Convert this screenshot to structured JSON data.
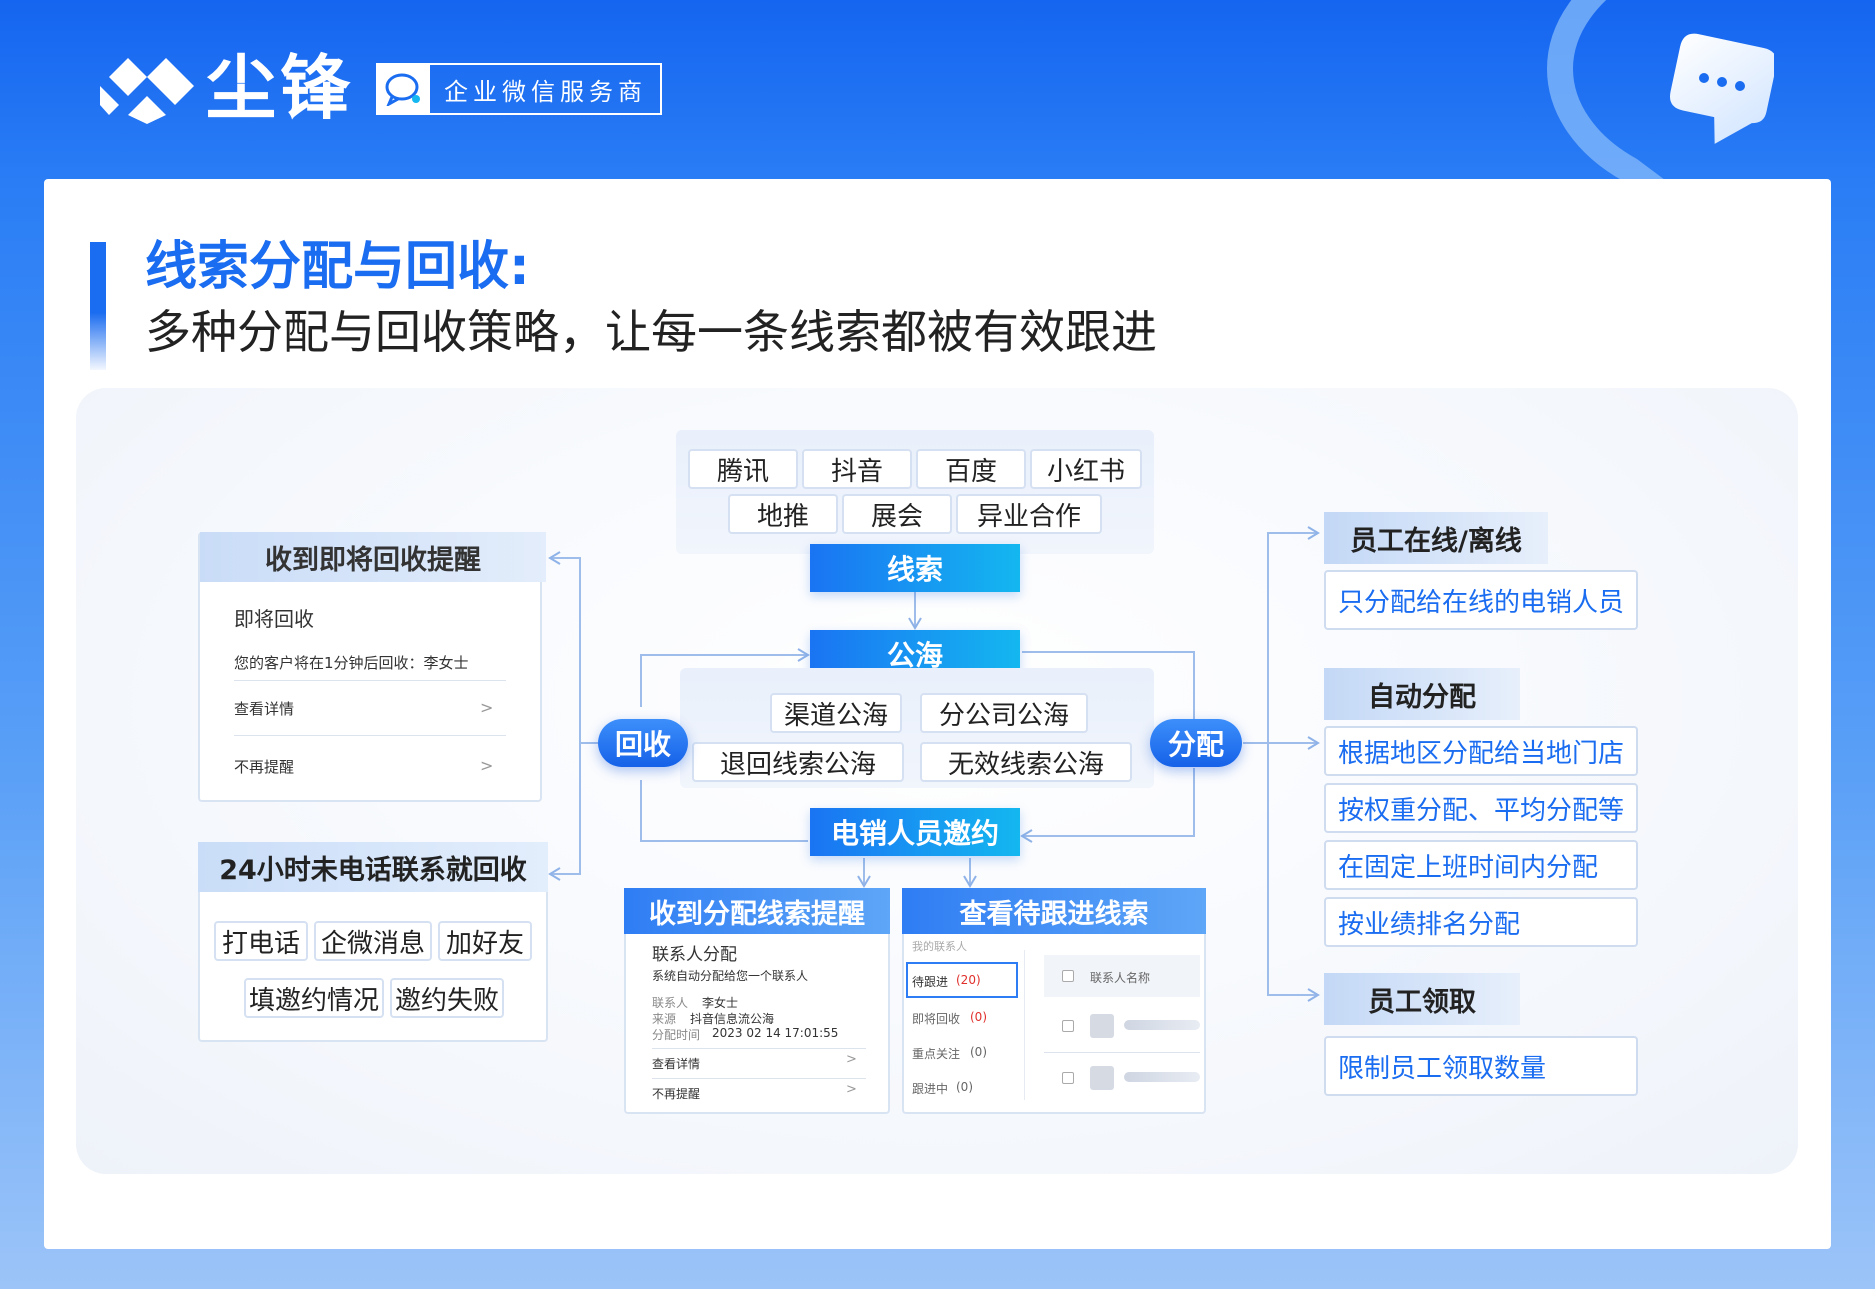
{
  "header": {
    "brand": "尘锋",
    "service_badge": "企业微信服务商",
    "colors": {
      "primary": "#1a6cf0",
      "accent": "#14b7f0"
    }
  },
  "title": {
    "main": "线索分配与回收:",
    "sub": "多种分配与回收策略，让每一条线索都被有效跟进"
  },
  "sources": {
    "row1": [
      "腾讯",
      "抖音",
      "百度",
      "小红书"
    ],
    "row2": [
      "地推",
      "展会",
      "异业合作"
    ]
  },
  "flow": {
    "leads": "线索",
    "public_sea": "公海",
    "telesales_invite": "电销人员邀约",
    "recycle": "回收",
    "assign": "分配"
  },
  "sea_types": {
    "row1": [
      "渠道公海",
      "分公司公海"
    ],
    "row2": [
      "退回线索公海",
      "无效线索公海"
    ]
  },
  "recycle_reminder": {
    "header": "收到即将回收提醒",
    "title": "即将回收",
    "message": "您的客户将在1分钟后回收：李女士",
    "view_details": "查看详情",
    "no_remind": "不再提醒"
  },
  "recycle_24h": {
    "header": "24小时未电话联系就回收",
    "row1": [
      "打电话",
      "企微消息",
      "加好友"
    ],
    "row2": [
      "填邀约情况",
      "邀约失败"
    ]
  },
  "assign_reminder": {
    "header": "收到分配线索提醒",
    "title": "联系人分配",
    "message": "系统自动分配给您一个联系人",
    "contact_label": "联系人",
    "contact_value": "李女士",
    "source_label": "来源",
    "source_value": "抖音信息流公海",
    "time_label": "分配时间",
    "time_value": "2023 02 14  17:01:55",
    "view_details": "查看详情",
    "no_remind": "不再提醒"
  },
  "pending_leads": {
    "header": "查看待跟进线索",
    "sidebar_title": "我的联系人",
    "tabs": [
      {
        "label": "待跟进",
        "count": "(20)"
      },
      {
        "label": "即将回收",
        "count": "(0)"
      },
      {
        "label": "重点关注",
        "count": "(0)"
      },
      {
        "label": "跟进中",
        "count": "(0)"
      }
    ],
    "column_header": "联系人名称"
  },
  "right": {
    "online": {
      "header": "员工在线/离线",
      "items": [
        "只分配给在线的电销人员"
      ]
    },
    "auto": {
      "header": "自动分配",
      "items": [
        "根据地区分配给当地门店",
        "按权重分配、平均分配等",
        "在固定上班时间内分配",
        "按业绩排名分配"
      ]
    },
    "claim": {
      "header": "员工领取",
      "items": [
        "限制员工领取数量"
      ]
    }
  }
}
